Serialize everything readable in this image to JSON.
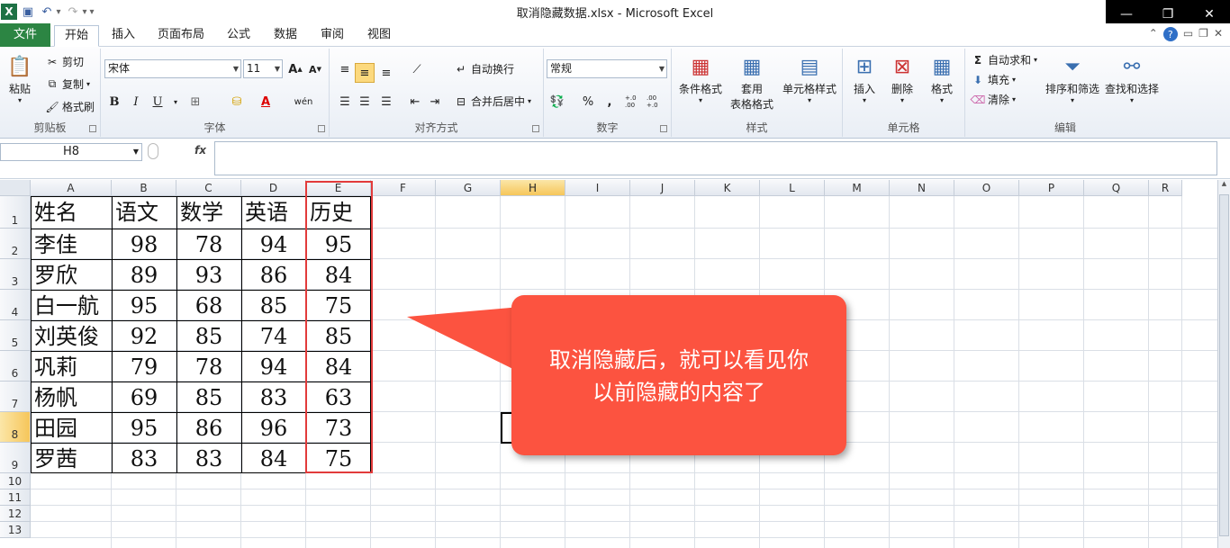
{
  "window": {
    "title": "取消隐藏数据.xlsx  -  Microsoft Excel",
    "logo": "X"
  },
  "tabs": [
    "文件",
    "开始",
    "插入",
    "页面布局",
    "公式",
    "数据",
    "审阅",
    "视图"
  ],
  "ribbon": {
    "clipboard": {
      "label": "剪贴板",
      "paste": "粘贴",
      "cut": "剪切",
      "copy": "复制",
      "format_painter": "格式刷"
    },
    "font": {
      "label": "字体",
      "font_name": "宋体",
      "font_size": "11",
      "grow": "A",
      "shrink": "A",
      "bold": "B",
      "italic": "I",
      "underline": "U",
      "font_color": "A",
      "phonetic": "wén"
    },
    "alignment": {
      "label": "对齐方式",
      "wrap_text": "自动换行",
      "merge_center": "合并后居中"
    },
    "number": {
      "label": "数字",
      "format": "常规",
      "percent": "%",
      "comma": ",",
      "inc_decimal": "+.0 .00",
      "dec_decimal": ".00 +.0"
    },
    "styles": {
      "label": "样式",
      "conditional": "条件格式",
      "table_format_1": "套用",
      "table_format_2": "表格格式",
      "cell_styles": "单元格样式"
    },
    "cells": {
      "label": "单元格",
      "insert": "插入",
      "delete": "删除",
      "format": "格式"
    },
    "editing": {
      "label": "编辑",
      "autosum": "自动求和",
      "fill": "填充",
      "clear": "清除",
      "sort_filter": "排序和筛选",
      "find_select": "查找和选择"
    }
  },
  "formula_bar": {
    "name_box": "H8",
    "fx": "fx",
    "value": ""
  },
  "sheet": {
    "columns": [
      "A",
      "B",
      "C",
      "D",
      "E",
      "F",
      "G",
      "H",
      "I",
      "J",
      "K",
      "L",
      "M",
      "N",
      "O",
      "P",
      "Q",
      "R"
    ],
    "rows": [
      "1",
      "2",
      "3",
      "4",
      "5",
      "6",
      "7",
      "8",
      "9",
      "10",
      "11",
      "12",
      "13"
    ],
    "selected_cell": "H8",
    "table": {
      "headers": [
        "姓名",
        "语文",
        "数学",
        "英语",
        "历史"
      ],
      "rows": [
        [
          "李佳",
          "98",
          "78",
          "94",
          "95"
        ],
        [
          "罗欣",
          "89",
          "93",
          "86",
          "84"
        ],
        [
          "白一航",
          "95",
          "68",
          "85",
          "75"
        ],
        [
          "刘英俊",
          "92",
          "85",
          "74",
          "85"
        ],
        [
          "巩莉",
          "79",
          "78",
          "94",
          "84"
        ],
        [
          "杨帆",
          "69",
          "85",
          "83",
          "63"
        ],
        [
          "田园",
          "95",
          "86",
          "96",
          "73"
        ],
        [
          "罗茜",
          "83",
          "83",
          "84",
          "75"
        ]
      ]
    }
  },
  "callout": {
    "line1": "取消隐藏后，就可以看见你",
    "line2": "以前隐藏的内容了",
    "color": "#fc5340"
  },
  "colors": {
    "file_tab": "#2c8543",
    "selection_header": "#f6c65a",
    "highlight_box": "#e23b3b"
  }
}
